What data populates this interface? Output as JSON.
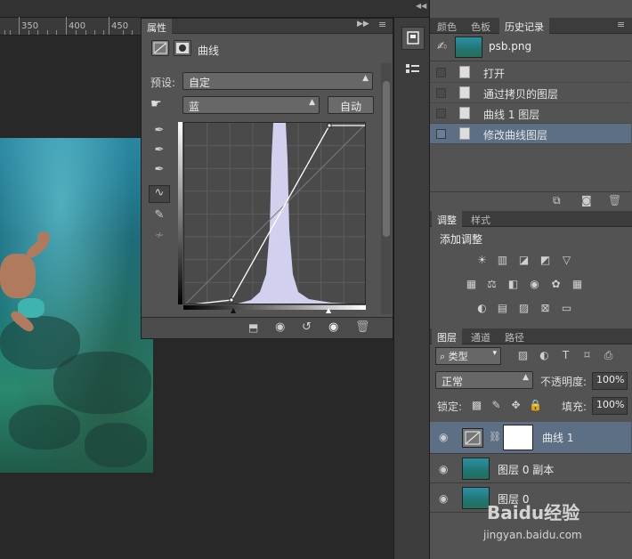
{
  "ruler": {
    "marks": [
      "350",
      "400",
      "450"
    ]
  },
  "properties": {
    "tab_label": "属性",
    "adjustment_name": "曲线",
    "preset_label": "预设:",
    "preset_value": "自定",
    "channel_value": "蓝",
    "auto_button": "自动"
  },
  "history": {
    "tabs": [
      "颜色",
      "色板",
      "历史记录"
    ],
    "active_tab": "历史记录",
    "snapshot_name": "psb.png",
    "items": [
      "打开",
      "通过拷贝的图层",
      "曲线 1 图层",
      "修改曲线图层"
    ],
    "selected_item": "修改曲线图层"
  },
  "adjustments": {
    "tabs": [
      "调整",
      "样式"
    ],
    "active_tab": "调整",
    "heading": "添加调整"
  },
  "layers": {
    "tabs": [
      "图层",
      "通道",
      "路径"
    ],
    "active_tab": "图层",
    "filter_kind": "类型",
    "blend_mode": "正常",
    "opacity_label": "不透明度:",
    "opacity_value": "100%",
    "lock_label": "锁定:",
    "fill_label": "填充:",
    "fill_value": "100%",
    "items": [
      {
        "name": "曲线 1",
        "type": "adjustment",
        "selected": true
      },
      {
        "name": "图层 0 副本",
        "type": "pixel",
        "selected": false
      },
      {
        "name": "图层 0",
        "type": "pixel",
        "selected": false
      }
    ]
  },
  "watermark": {
    "brand": "Baidu经验",
    "url": "jingyan.baidu.com"
  },
  "colors": {
    "panel": "#535353",
    "selected_row": "#5c6f85",
    "curve_fill": "#d8d8f8"
  }
}
